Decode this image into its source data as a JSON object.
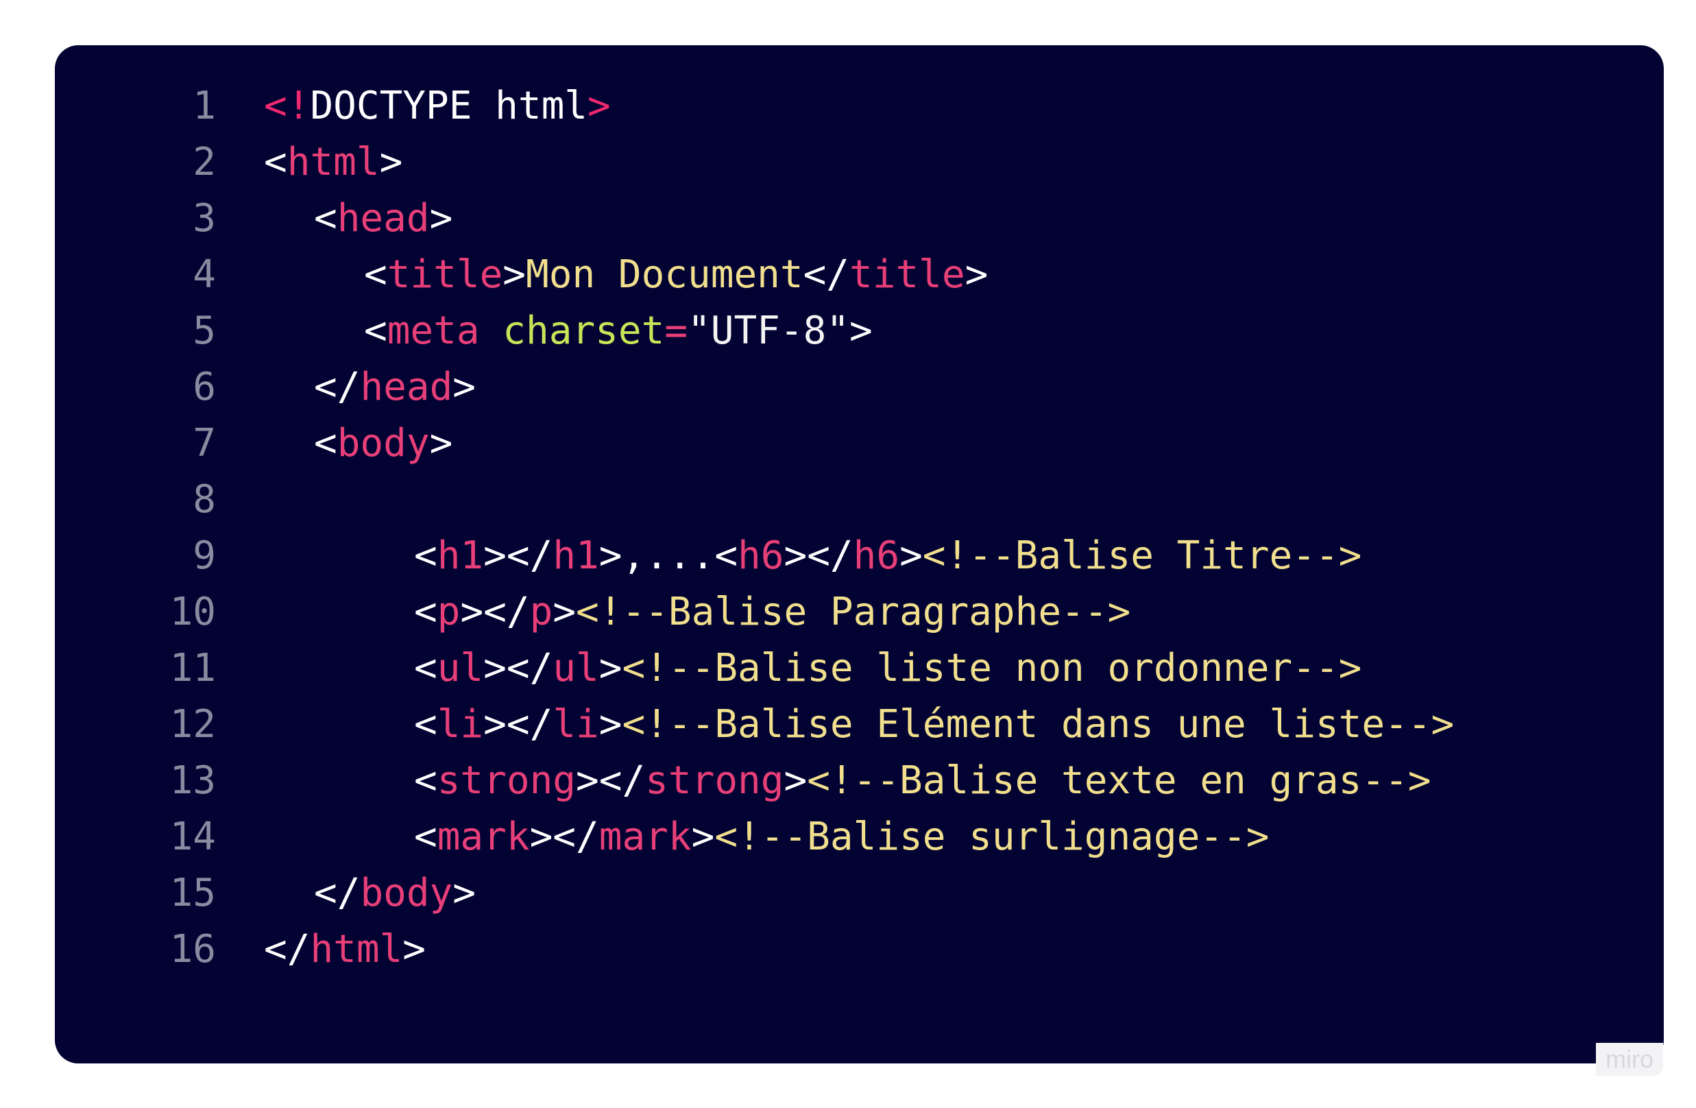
{
  "editor": {
    "background": "#030333",
    "lines": [
      {
        "number": "1",
        "indent": 0,
        "tokens": [
          {
            "text": "<!",
            "kind": "tag"
          },
          {
            "text": "DOCTYPE html",
            "kind": "doctype"
          },
          {
            "text": ">",
            "kind": "tag"
          }
        ]
      },
      {
        "number": "2",
        "indent": 0,
        "tokens": [
          {
            "text": "<",
            "kind": "bracket"
          },
          {
            "text": "html",
            "kind": "tagname"
          },
          {
            "text": ">",
            "kind": "bracket"
          }
        ]
      },
      {
        "number": "3",
        "indent": 1,
        "tokens": [
          {
            "text": "<",
            "kind": "bracket"
          },
          {
            "text": "head",
            "kind": "tagname"
          },
          {
            "text": ">",
            "kind": "bracket"
          }
        ]
      },
      {
        "number": "4",
        "indent": 2,
        "tokens": [
          {
            "text": "<",
            "kind": "bracket"
          },
          {
            "text": "title",
            "kind": "tagname"
          },
          {
            "text": ">",
            "kind": "bracket"
          },
          {
            "text": "Mon Document",
            "kind": "text"
          },
          {
            "text": "</",
            "kind": "bracket"
          },
          {
            "text": "title",
            "kind": "tagname"
          },
          {
            "text": ">",
            "kind": "bracket"
          }
        ]
      },
      {
        "number": "5",
        "indent": 2,
        "tokens": [
          {
            "text": "<",
            "kind": "bracket"
          },
          {
            "text": "meta",
            "kind": "tagname"
          },
          {
            "text": " ",
            "kind": "bracket"
          },
          {
            "text": "charset",
            "kind": "attr"
          },
          {
            "text": "=",
            "kind": "tagname"
          },
          {
            "text": "\"UTF-8\"",
            "kind": "string"
          },
          {
            "text": ">",
            "kind": "bracket"
          }
        ]
      },
      {
        "number": "6",
        "indent": 1,
        "tokens": [
          {
            "text": "</",
            "kind": "bracket"
          },
          {
            "text": "head",
            "kind": "tagname"
          },
          {
            "text": ">",
            "kind": "bracket"
          }
        ]
      },
      {
        "number": "7",
        "indent": 1,
        "tokens": [
          {
            "text": "<",
            "kind": "bracket"
          },
          {
            "text": "body",
            "kind": "tagname"
          },
          {
            "text": ">",
            "kind": "bracket"
          }
        ]
      },
      {
        "number": "8",
        "indent": 0,
        "tokens": []
      },
      {
        "number": "9",
        "indent": 3,
        "tokens": [
          {
            "text": "<",
            "kind": "bracket"
          },
          {
            "text": "h1",
            "kind": "tagname"
          },
          {
            "text": "></",
            "kind": "bracket"
          },
          {
            "text": "h1",
            "kind": "tagname"
          },
          {
            "text": ">,...<",
            "kind": "bracket"
          },
          {
            "text": "h6",
            "kind": "tagname"
          },
          {
            "text": "></",
            "kind": "bracket"
          },
          {
            "text": "h6",
            "kind": "tagname"
          },
          {
            "text": ">",
            "kind": "bracket"
          },
          {
            "text": "<!--Balise Titre-->",
            "kind": "comment"
          }
        ]
      },
      {
        "number": "10",
        "indent": 3,
        "tokens": [
          {
            "text": "<",
            "kind": "bracket"
          },
          {
            "text": "p",
            "kind": "tagname"
          },
          {
            "text": "></",
            "kind": "bracket"
          },
          {
            "text": "p",
            "kind": "tagname"
          },
          {
            "text": ">",
            "kind": "bracket"
          },
          {
            "text": "<!--Balise Paragraphe-->",
            "kind": "comment"
          }
        ]
      },
      {
        "number": "11",
        "indent": 3,
        "tokens": [
          {
            "text": "<",
            "kind": "bracket"
          },
          {
            "text": "ul",
            "kind": "tagname"
          },
          {
            "text": "></",
            "kind": "bracket"
          },
          {
            "text": "ul",
            "kind": "tagname"
          },
          {
            "text": ">",
            "kind": "bracket"
          },
          {
            "text": "<!--Balise liste non ordonner-->",
            "kind": "comment"
          }
        ]
      },
      {
        "number": "12",
        "indent": 3,
        "tokens": [
          {
            "text": "<",
            "kind": "bracket"
          },
          {
            "text": "li",
            "kind": "tagname"
          },
          {
            "text": "></",
            "kind": "bracket"
          },
          {
            "text": "li",
            "kind": "tagname"
          },
          {
            "text": ">",
            "kind": "bracket"
          },
          {
            "text": "<!--Balise Elément dans une liste-->",
            "kind": "comment"
          }
        ]
      },
      {
        "number": "13",
        "indent": 3,
        "tokens": [
          {
            "text": "<",
            "kind": "bracket"
          },
          {
            "text": "strong",
            "kind": "tagname"
          },
          {
            "text": "></",
            "kind": "bracket"
          },
          {
            "text": "strong",
            "kind": "tagname"
          },
          {
            "text": ">",
            "kind": "bracket"
          },
          {
            "text": "<!--Balise texte en gras-->",
            "kind": "comment"
          }
        ]
      },
      {
        "number": "14",
        "indent": 3,
        "tokens": [
          {
            "text": "<",
            "kind": "bracket"
          },
          {
            "text": "mark",
            "kind": "tagname"
          },
          {
            "text": "></",
            "kind": "bracket"
          },
          {
            "text": "mark",
            "kind": "tagname"
          },
          {
            "text": ">",
            "kind": "bracket"
          },
          {
            "text": "<!--Balise surlignage-->",
            "kind": "comment"
          }
        ]
      },
      {
        "number": "15",
        "indent": 1,
        "tokens": [
          {
            "text": "</",
            "kind": "bracket"
          },
          {
            "text": "body",
            "kind": "tagname"
          },
          {
            "text": ">",
            "kind": "bracket"
          }
        ]
      },
      {
        "number": "16",
        "indent": 0,
        "tokens": [
          {
            "text": "</",
            "kind": "bracket"
          },
          {
            "text": "html",
            "kind": "tagname"
          },
          {
            "text": ">",
            "kind": "bracket"
          }
        ]
      }
    ]
  },
  "watermark": {
    "label": "miro"
  }
}
